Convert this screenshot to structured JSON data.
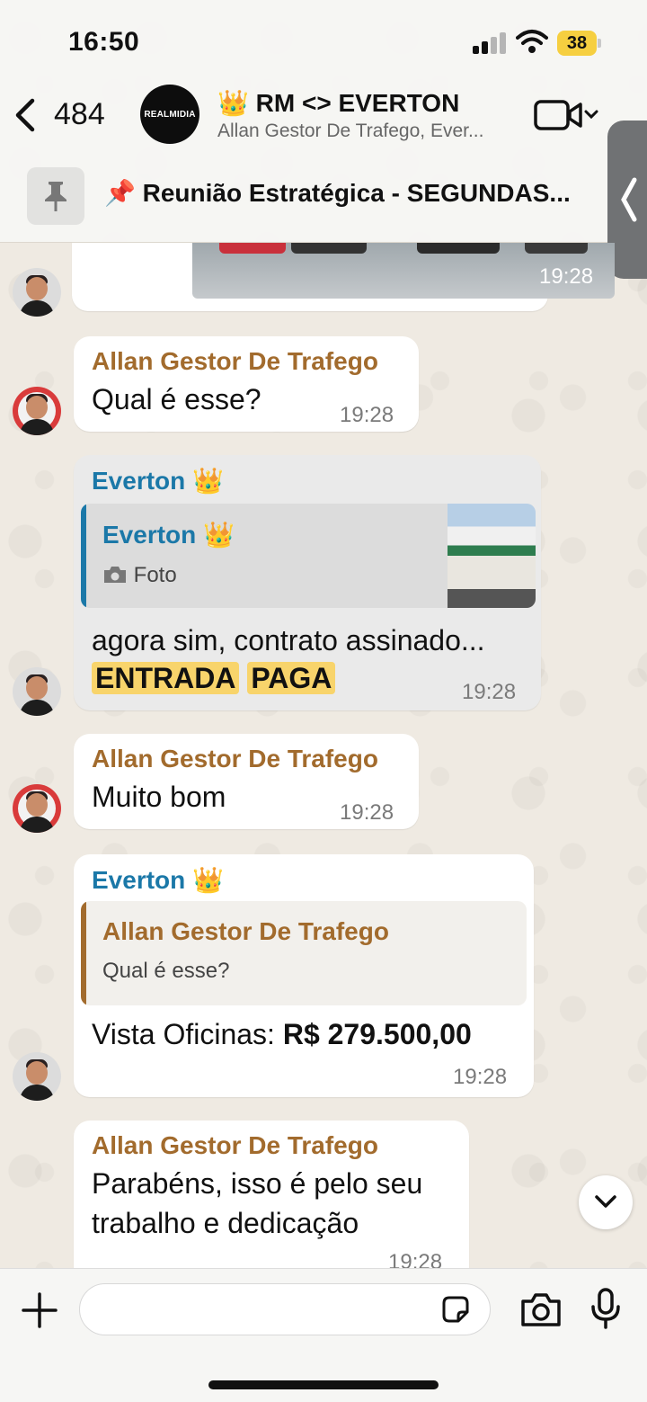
{
  "status_bar": {
    "time": "16:50",
    "battery": "38"
  },
  "header": {
    "back_count": "484",
    "group_avatar_text": "REALMIDIA",
    "group_title": "👑 RM <> EVERTON",
    "group_subtitle": "Allan Gestor De Trafego, Ever...",
    "pinned_message": "📌 Reunião Estratégica - SEGUNDAS..."
  },
  "messages": [
    {
      "type": "image",
      "time": "19:28"
    },
    {
      "sender": "Allan Gestor De Trafego",
      "text": "Qual é esse?",
      "time": "19:28"
    },
    {
      "sender": "Everton 👑",
      "quote": {
        "sender": "Everton 👑",
        "text": "Foto",
        "icon": "camera-icon"
      },
      "text_line1": "agora sim, contrato assinado...",
      "highlight1": "ENTRADA",
      "highlight2": "PAGA",
      "time": "19:28"
    },
    {
      "sender": "Allan Gestor De Trafego",
      "text": "Muito bom",
      "time": "19:28"
    },
    {
      "sender": "Everton 👑",
      "quote": {
        "sender": "Allan Gestor De Trafego",
        "text": "Qual é esse?"
      },
      "text_prefix": "Vista Oficinas: ",
      "text_bold": "R$ 279.500,00",
      "time": "19:28"
    },
    {
      "sender": "Allan Gestor De Trafego",
      "text_line1": "Parabéns, isso é pelo seu",
      "text_line2": "trabalho e dedicação",
      "time": "19:28"
    }
  ],
  "input": {
    "placeholder": ""
  },
  "colors": {
    "allan": "#a26b2d",
    "everton": "#1b78a8",
    "highlight": "#f8d46b"
  }
}
